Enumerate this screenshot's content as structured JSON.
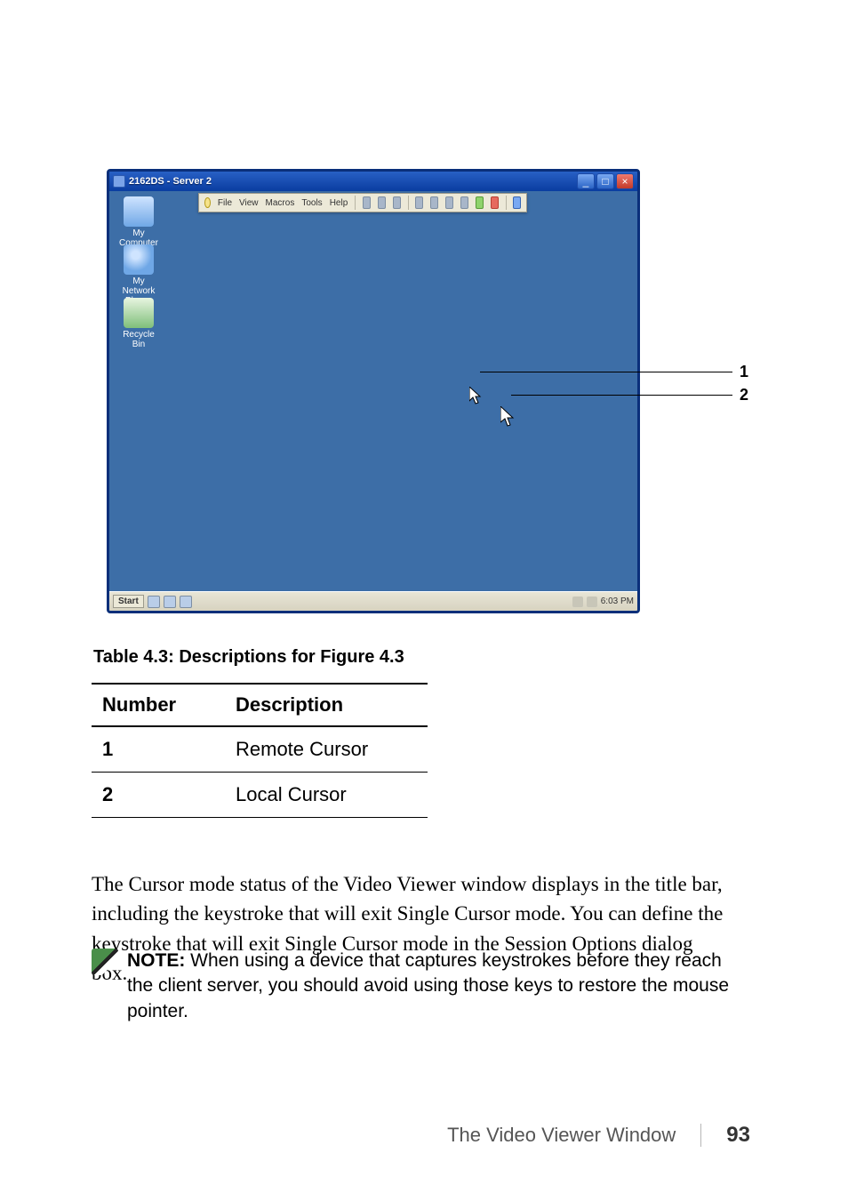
{
  "screenshot": {
    "title": "2162DS - Server 2",
    "menu": {
      "file": "File",
      "view": "View",
      "macros": "Macros",
      "tools": "Tools",
      "help": "Help"
    },
    "desktop": {
      "my_computer": "My Computer",
      "my_network": "My Network Places",
      "recycle_bin": "Recycle Bin"
    },
    "taskbar": {
      "start": "Start",
      "clock": "6:03 PM"
    }
  },
  "callouts": {
    "one": "1",
    "two": "2"
  },
  "table": {
    "caption": "Table 4.3: Descriptions for Figure 4.3",
    "headers": {
      "num": "Number",
      "desc": "Description"
    },
    "rows": [
      {
        "num": "1",
        "desc": "Remote Cursor"
      },
      {
        "num": "2",
        "desc": "Local Cursor"
      }
    ]
  },
  "body_para": "The Cursor mode status of the Video Viewer window displays in the title bar, including the keystroke that will exit Single Cursor mode. You can define the keystroke that will exit Single Cursor mode in the Session Options dialog box.",
  "note": {
    "label": "NOTE:",
    "text": " When using a device that captures keystrokes before they reach the client server, you should avoid using those keys to restore the mouse pointer."
  },
  "footer": {
    "section": "The Video Viewer Window",
    "page": "93"
  }
}
